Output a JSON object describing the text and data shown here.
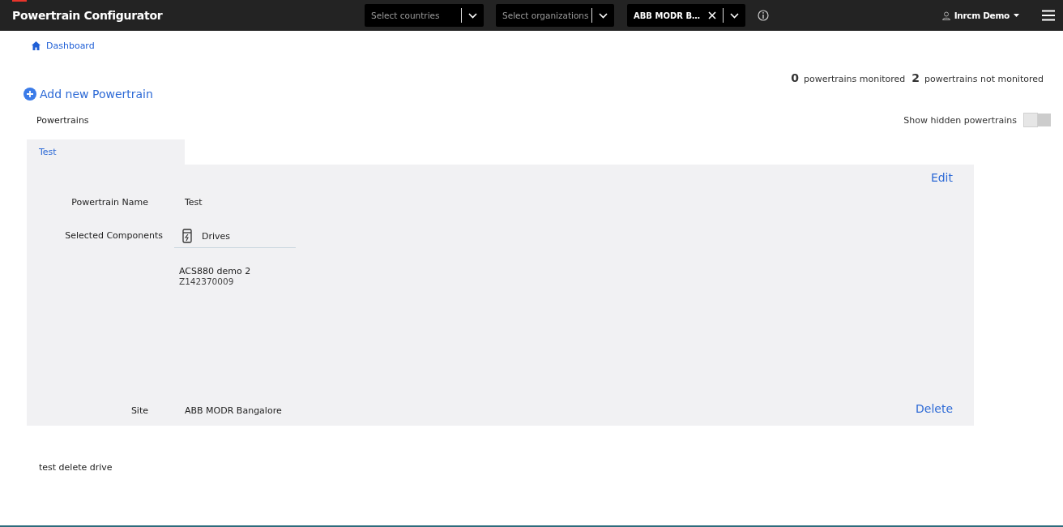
{
  "header": {
    "title": "Powertrain Configurator",
    "filters": [
      {
        "placeholder": "Select countries"
      },
      {
        "placeholder": "Select organizations"
      },
      {
        "value": "ABB MODR B…"
      }
    ],
    "user": "Inrcm Demo"
  },
  "breadcrumb": "Dashboard",
  "stats": [
    {
      "count": "0",
      "label": "powertrains monitored"
    },
    {
      "count": "2",
      "label": "powertrains not monitored"
    }
  ],
  "add_button": "Add new Powertrain",
  "section_title": "Powertrains",
  "hidden_toggle": {
    "label": "Show hidden powertrains",
    "on": false
  },
  "powertrains": [
    {
      "name": "Test",
      "selected": true,
      "details": {
        "edit": "Edit",
        "name_label": "Powertrain Name",
        "name_value": "Test",
        "components_label": "Selected Components",
        "component_group": "Drives",
        "components": [
          {
            "name": "ACS880 demo 2",
            "serial": "Z142370009"
          }
        ],
        "site_label": "Site",
        "site_value": "ABB MODR Bangalore",
        "delete": "Delete"
      }
    },
    {
      "name": "test delete drive",
      "selected": false
    }
  ]
}
